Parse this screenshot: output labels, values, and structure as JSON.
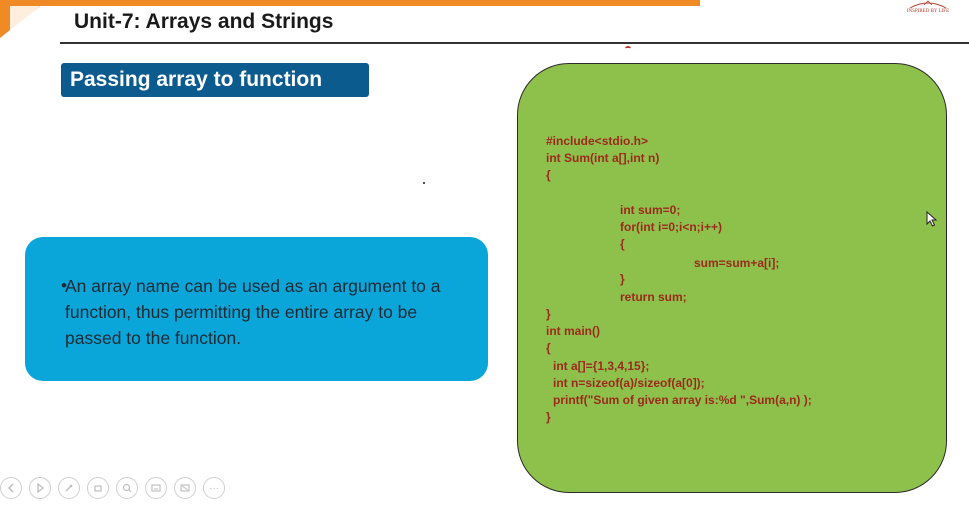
{
  "header": {
    "title": "Unit-7: Arrays and Strings",
    "logo_text": "INSPIRED BY LIFE"
  },
  "section": {
    "title": "Passing array to function"
  },
  "bullet": {
    "marker": "•",
    "text": "An array name can be used as an argument to a function, thus permitting the entire array to be passed to the function."
  },
  "code": {
    "lines": [
      "#include<stdio.h>",
      "int Sum(int a[],int n)",
      "{",
      "int sum=0;",
      "for(int i=0;i<n;i++)",
      "{",
      "sum=sum+a[i];",
      "}",
      "return sum;",
      "}",
      "int main()",
      "{",
      "int a[]={1,3,4,15};",
      "int n=sizeof(a)/sizeof(a[0]);",
      "printf(\"Sum of given array is:%d \",Sum(a,n) );",
      "}"
    ]
  },
  "toolbar": {
    "icons": [
      "prev-icon",
      "play-icon",
      "pen-icon",
      "eraser-icon",
      "zoom-icon",
      "subtitles-icon",
      "slides-icon",
      "more-icon"
    ],
    "more_label": "···"
  },
  "colors": {
    "accent_orange": "#f08a24",
    "badge_blue": "#0c5b8f",
    "card_cyan": "#0aa6da",
    "code_green": "#8ec14c",
    "code_text": "#9c2a1c"
  }
}
